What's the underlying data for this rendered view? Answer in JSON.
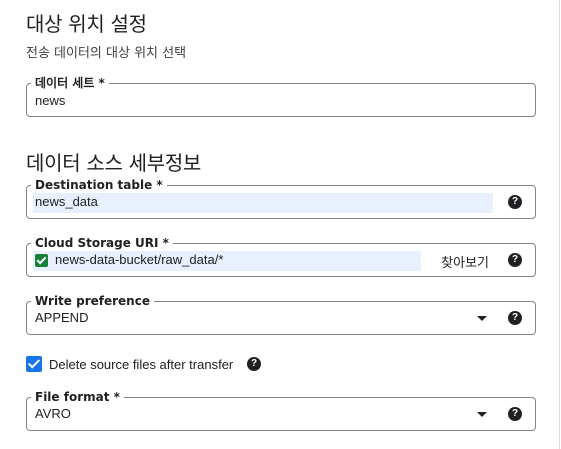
{
  "destination": {
    "heading": "대상 위치 설정",
    "subtext": "전송 데이터의 대상 위치 선택",
    "dataset": {
      "label": "데이터 세트 *",
      "value": "news"
    }
  },
  "source": {
    "heading": "데이터 소스 세부정보",
    "destination_table": {
      "label": "Destination table *",
      "value": "news_data",
      "help_icon": "help-icon"
    },
    "cloud_storage_uri": {
      "label": "Cloud Storage URI *",
      "value": "news-data-bucket/raw_data/*",
      "browse_label": "찾아보기",
      "status_icon": "check-icon",
      "help_icon": "help-icon"
    },
    "write_preference": {
      "label": "Write preference",
      "value": "APPEND",
      "help_icon": "help-icon"
    },
    "delete_source": {
      "label": "Delete source files after transfer",
      "checked": true,
      "help_icon": "help-icon"
    },
    "file_format": {
      "label": "File format *",
      "value": "AVRO",
      "help_icon": "help-icon"
    }
  },
  "help_glyph": "?",
  "colors": {
    "accent": "#1a73e8",
    "success": "#188038",
    "highlight": "#e8f0fe",
    "border": "#80868b"
  }
}
